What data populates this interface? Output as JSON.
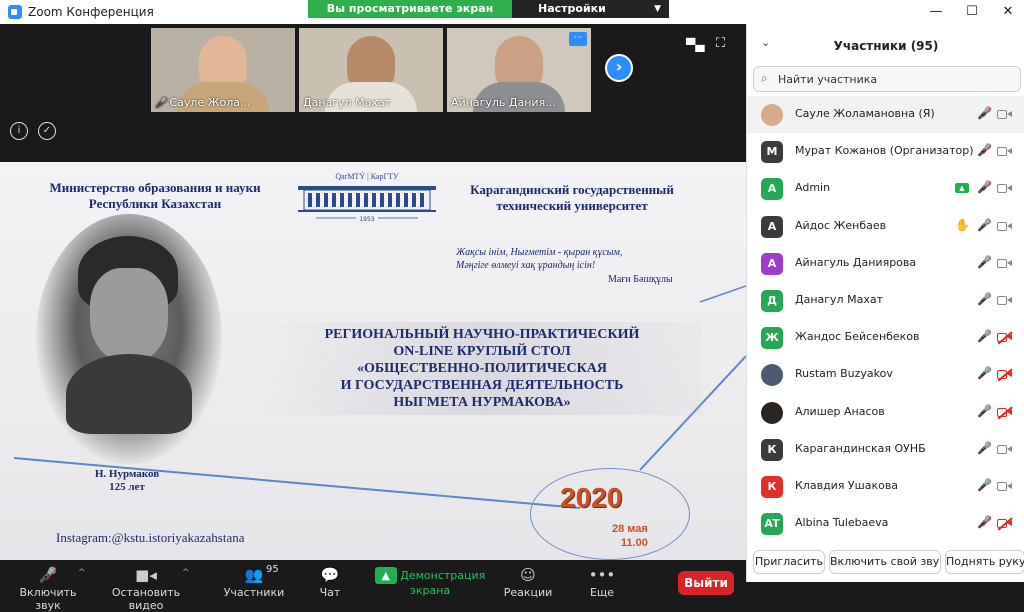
{
  "window": {
    "title": "Zoom Конференция",
    "share_banner": "Вы просматриваете экран Admin",
    "view_options": "Настройки просмотра"
  },
  "thumbnails": [
    {
      "name": "Сауле Жола...",
      "muted": true
    },
    {
      "name": "Данагул Махат",
      "muted": false
    },
    {
      "name": "Айнагуль Дания...",
      "muted": false
    }
  ],
  "slide": {
    "ministry": "Министерство образования и науки Республики Казахстан",
    "logo_text": "QarMTÝ | КарГТУ",
    "logo_year": "1953",
    "university": "Карагандинский государственный технический университет",
    "poem_line_1": "Жақсы інім, Нығметім - қыран құсым,",
    "poem_line_2": "Мәңгіге өлмеуі хақ ұрандың ісін!",
    "poem_author": "Мағи Бәшқұлы",
    "headline_1": "РЕГИОНАЛЬНЫЙ НАУЧНО-ПРАКТИЧЕСКИЙ",
    "headline_2": "ON-LINE КРУГЛЫЙ СТОЛ",
    "headline_3": "«ОБЩЕСТВЕННО-ПОЛИТИЧЕСКАЯ",
    "headline_4": "И ГОСУДАРСТВЕННАЯ ДЕЯТЕЛЬНОСТЬ",
    "headline_5": "НЫГМЕТА НУРМАКОВА»",
    "caption_name": "Н. Нурмаков",
    "caption_years": "125 лет",
    "year": "2020",
    "date": "28 мая",
    "time": "11.00",
    "instagram": "Instagram:@kstu.istoriyakazahstana"
  },
  "toolbar": {
    "unmute": "Включить звук",
    "start_video": "Остановить видео",
    "participants": "Участники",
    "participants_count": "95",
    "chat": "Чат",
    "share_screen": "Демонстрация экрана",
    "reactions": "Реакции",
    "more": "Еще",
    "leave": "Выйти"
  },
  "panel": {
    "title": "Участники (95)",
    "search_placeholder": "Найти участника",
    "participants": [
      {
        "name": "Сауле Жоламановна (Я)",
        "avatar": "",
        "avatar_color": "#d8a98a",
        "mic": "off",
        "cam": "on",
        "share": false,
        "hand": false
      },
      {
        "name": "Мурат Кожанов (Организатор)",
        "avatar": "М",
        "avatar_color": "#3b3b3b",
        "mic": "off",
        "cam": "on",
        "share": false,
        "hand": false
      },
      {
        "name": "Admin",
        "avatar": "A",
        "avatar_color": "#23a857",
        "mic": "off",
        "cam": "on",
        "share": true,
        "hand": false
      },
      {
        "name": "Айдос Женбаев",
        "avatar": "А",
        "avatar_color": "#3b3b3b",
        "mic": "on",
        "cam": "on",
        "share": false,
        "hand": true
      },
      {
        "name": "Айнагуль Даниярова",
        "avatar": "А",
        "avatar_color": "#9b3ec8",
        "mic": "on",
        "cam": "on",
        "share": false,
        "hand": false
      },
      {
        "name": "Данагул Махат",
        "avatar": "Д",
        "avatar_color": "#23a857",
        "mic": "on",
        "cam": "on",
        "share": false,
        "hand": false
      },
      {
        "name": "Жандос Бейсенбеков",
        "avatar": "Ж",
        "avatar_color": "#23a857",
        "mic": "on",
        "cam": "off",
        "share": false,
        "hand": false
      },
      {
        "name": "Rustam Buzyakov",
        "avatar": "",
        "avatar_color": "#4a5a6e",
        "mic": "on",
        "cam": "off",
        "share": false,
        "hand": false
      },
      {
        "name": "Алишер Анасов",
        "avatar": "",
        "avatar_color": "#2a2520",
        "mic": "on",
        "cam": "off",
        "share": false,
        "hand": false
      },
      {
        "name": "Карагандинская ОУНБ",
        "avatar": "К",
        "avatar_color": "#3b3b3b",
        "mic": "on",
        "cam": "on",
        "share": false,
        "hand": false
      },
      {
        "name": "Клавдия Ушакова",
        "avatar": "К",
        "avatar_color": "#e0302a",
        "mic": "on",
        "cam": "on",
        "share": false,
        "hand": false
      },
      {
        "name": "Albina Tulebaeva",
        "avatar": "AT",
        "avatar_color": "#23a857",
        "mic": "off",
        "cam": "off",
        "share": false,
        "hand": false
      }
    ],
    "invite": "Пригласить",
    "unmute_self": "Включить свой звук",
    "raise_hand": "Поднять руку"
  }
}
